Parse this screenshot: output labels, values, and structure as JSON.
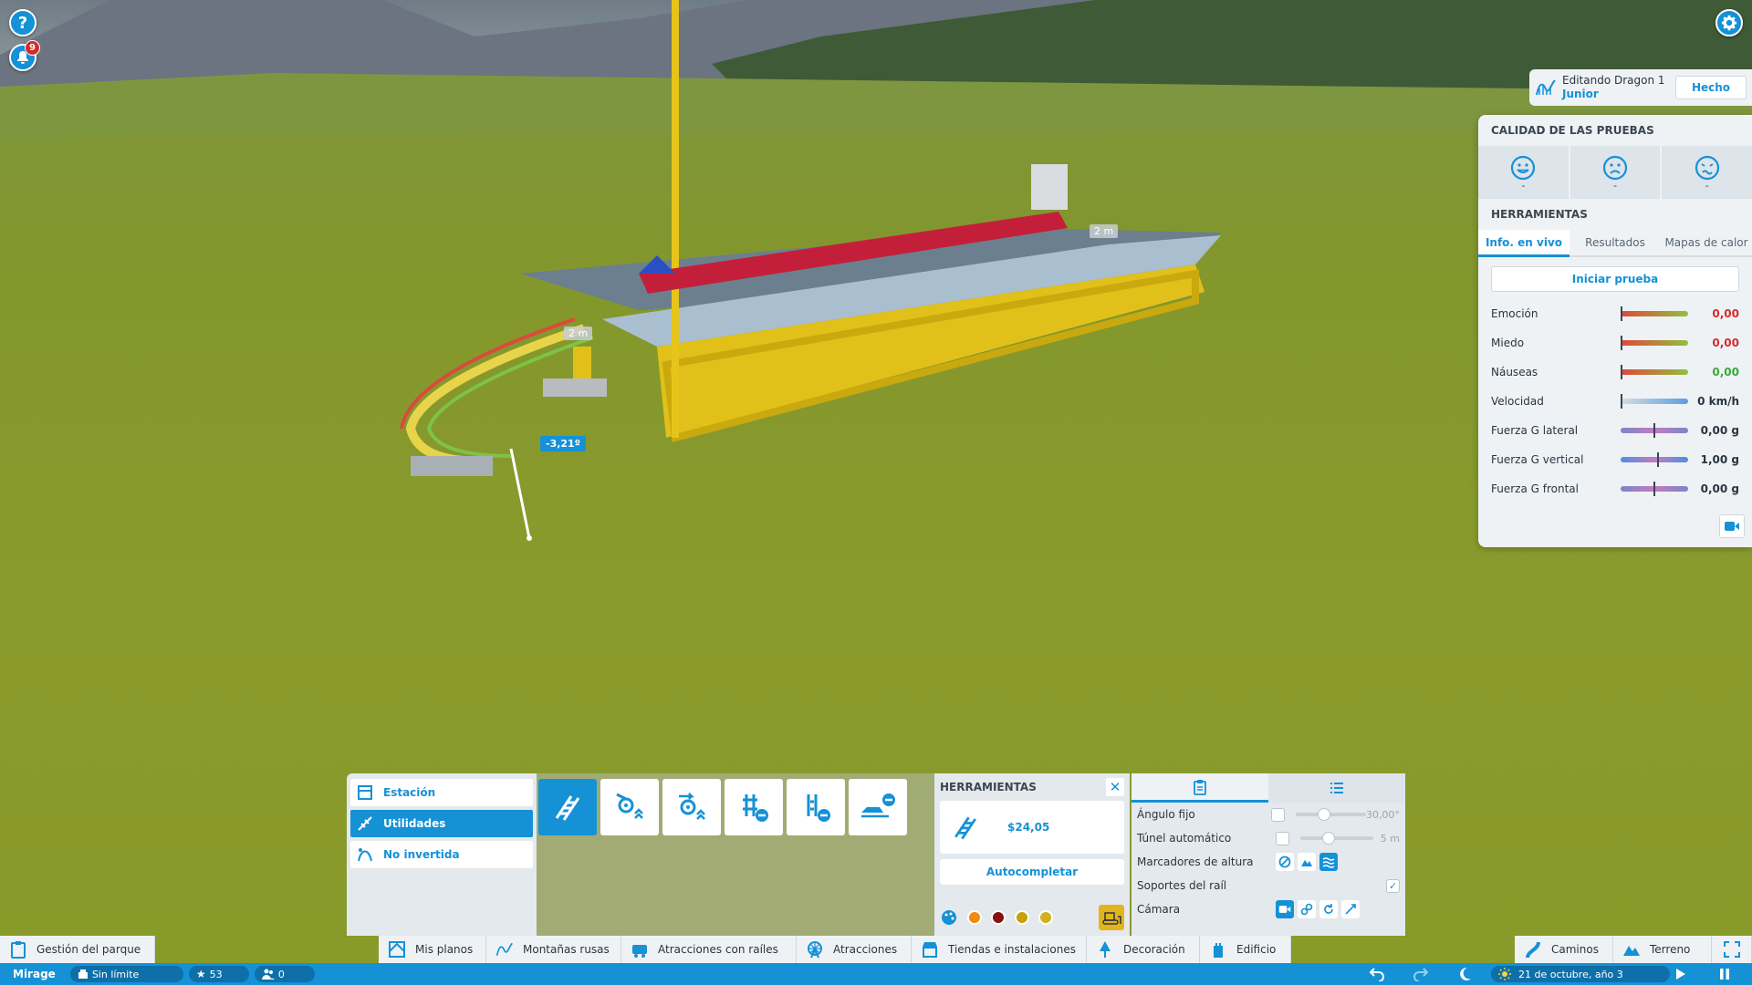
{
  "scene": {
    "distance_label_1": "2 m",
    "distance_label_2": "2 m",
    "angle_label": "-3,21º"
  },
  "top_left": {
    "help_glyph": "?",
    "notification_count": "9"
  },
  "edit_header": {
    "line1": "Editando Dragon 1",
    "line2": "Junior",
    "done_label": "Hecho"
  },
  "right_panel": {
    "quality_title": "CALIDAD DE LAS PRUEBAS",
    "faces": [
      {
        "icon": "happy-face-icon",
        "value": "-"
      },
      {
        "icon": "scared-face-icon",
        "value": "-"
      },
      {
        "icon": "nauseous-face-icon",
        "value": "-"
      }
    ],
    "tools_title": "HERRAMIENTAS",
    "tabs": [
      "Info. en vivo",
      "Resultados",
      "Mapas de calor"
    ],
    "start_test_label": "Iniciar prueba",
    "stats": [
      {
        "label": "Emoción",
        "value": "0,00",
        "color": "#d12d2d",
        "level": 0.0
      },
      {
        "label": "Miedo",
        "value": "0,00",
        "color": "#d12d2d",
        "level": 0.0
      },
      {
        "label": "Náuseas",
        "value": "0,00",
        "color": "#3aa83a",
        "level": 0.0
      },
      {
        "label": "Velocidad",
        "value": "0 km/h",
        "color": "#2a3440",
        "level": 0.0
      },
      {
        "label": "Fuerza G lateral",
        "value": "0,00 g",
        "color": "#2a3440",
        "level": 0.5
      },
      {
        "label": "Fuerza G vertical",
        "value": "1,00 g",
        "color": "#2a3440",
        "level": 0.55
      },
      {
        "label": "Fuerza G frontal",
        "value": "0,00 g",
        "color": "#2a3440",
        "level": 0.5
      }
    ]
  },
  "categories": [
    {
      "label": "Estación",
      "icon": "station-icon",
      "active": false
    },
    {
      "label": "Utilidades",
      "icon": "utilities-icon",
      "active": true
    },
    {
      "label": "No invertida",
      "icon": "non-inverted-icon",
      "active": false
    }
  ],
  "pieces": [
    "track-piece-icon",
    "lift-hill-icon",
    "booster-icon",
    "block-brake-remove-icon",
    "brake-remove-icon",
    "station-remove-icon"
  ],
  "tools_panel": {
    "title": "HERRAMIENTAS",
    "close_glyph": "✕",
    "price": "$24,05",
    "autocomplete_label": "Autocompletar",
    "colors": [
      "#f08a10",
      "#8a0f10",
      "#c8a10a",
      "#d6b01c"
    ]
  },
  "options": {
    "rows": [
      {
        "label": "Ángulo fijo",
        "value": "30,00°"
      },
      {
        "label": "Túnel automático",
        "value": "5 m"
      },
      {
        "label": "Marcadores de altura"
      },
      {
        "label": "Soportes del raíl",
        "check": "✓"
      },
      {
        "label": "Cámara"
      }
    ]
  },
  "toolbar": {
    "park_management": "Gestión del parque",
    "my_blueprints": "Mis planos",
    "roller_coasters": "Montañas rusas",
    "track_rides": "Atracciones con raíles",
    "rides": "Atracciones",
    "shops": "Tiendas e instalaciones",
    "decoration": "Decoración",
    "building": "Edificio",
    "paths": "Caminos",
    "terrain": "Terreno"
  },
  "statusbar": {
    "park_name": "Mirage",
    "money": "Sin límite",
    "rating": "53",
    "guests": "0",
    "date": "21 de octubre, año 3"
  }
}
